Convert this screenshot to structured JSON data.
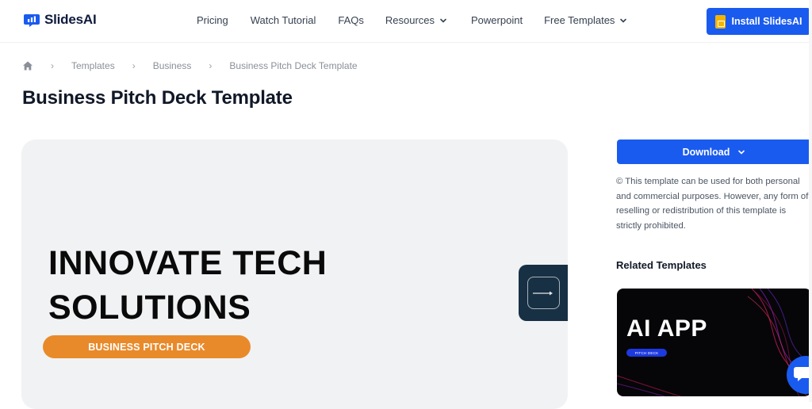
{
  "brand": {
    "name": "SlidesAI",
    "color": "#1a5bef"
  },
  "nav": [
    {
      "label": "Pricing",
      "has_dropdown": false
    },
    {
      "label": "Watch Tutorial",
      "has_dropdown": false
    },
    {
      "label": "FAQs",
      "has_dropdown": false
    },
    {
      "label": "Resources",
      "has_dropdown": true
    },
    {
      "label": "Powerpoint",
      "has_dropdown": false
    },
    {
      "label": "Free Templates",
      "has_dropdown": true
    }
  ],
  "install_button": {
    "label": "Install SlidesAI",
    "icon": "google-slides-icon"
  },
  "breadcrumb": {
    "home_icon": "home-icon",
    "items": [
      "Templates",
      "Business",
      "Business Pitch Deck Template"
    ]
  },
  "page": {
    "title": "Business Pitch Deck Template"
  },
  "preview": {
    "slide_title_line1": "INNOVATE TECH",
    "slide_title_line2": "SOLUTIONS",
    "slide_pill": "BUSINESS PITCH DECK",
    "next_icon": "arrow-right-icon"
  },
  "sidebar": {
    "download_label": "Download",
    "license_text": "© This template can be used for both personal and commercial purposes. However, any form of reselling or redistribution of this template is strictly prohibited.",
    "related_heading": "Related Templates",
    "related": [
      {
        "title": "AI APP",
        "badge": "PITCH DECK"
      }
    ]
  },
  "chat": {
    "icon": "chat-icon"
  }
}
